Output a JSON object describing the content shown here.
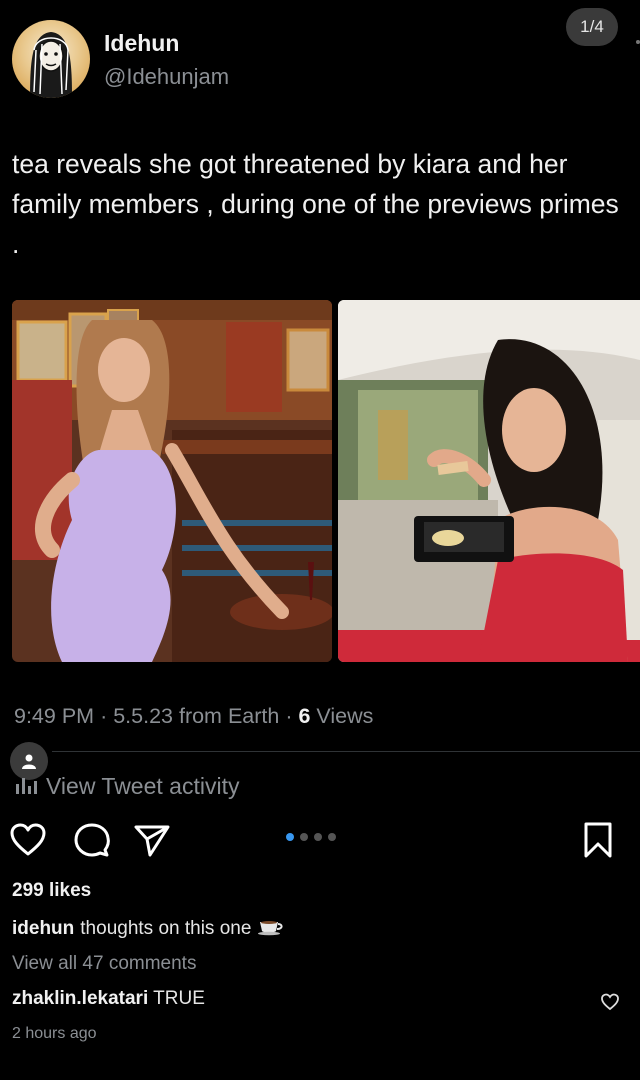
{
  "header": {
    "display_name": "Idehun",
    "handle": "@Idehunjam",
    "page_counter": "1/4"
  },
  "tweet": {
    "text": "tea reveals she got threatened by kiara and her family members , during one of the previews primes .",
    "time": "9:49 PM",
    "date": "5.5.23",
    "source": "from Earth",
    "views_count": "6",
    "views_label": "Views",
    "activity_label": "View Tweet activity"
  },
  "post": {
    "likes": "299 likes",
    "caption_user": "idehun",
    "caption_text": "thoughts on this one",
    "view_comments": "View all 47 comments",
    "comment_user": "zhaklin.lekatari",
    "comment_text": "TRUE",
    "time_ago": "2 hours ago"
  },
  "icons": {
    "like": "heart-icon",
    "comment": "comment-bubble-icon",
    "share": "paper-plane-icon",
    "save": "bookmark-icon",
    "activity": "bar-chart-icon",
    "user": "person-icon",
    "caption_emoji": "teacup-icon"
  },
  "colors": {
    "background": "#000000",
    "muted_text": "#8b8f94",
    "carousel_active": "#3897f0"
  },
  "carousel": {
    "total": 4,
    "active_index": 0
  }
}
